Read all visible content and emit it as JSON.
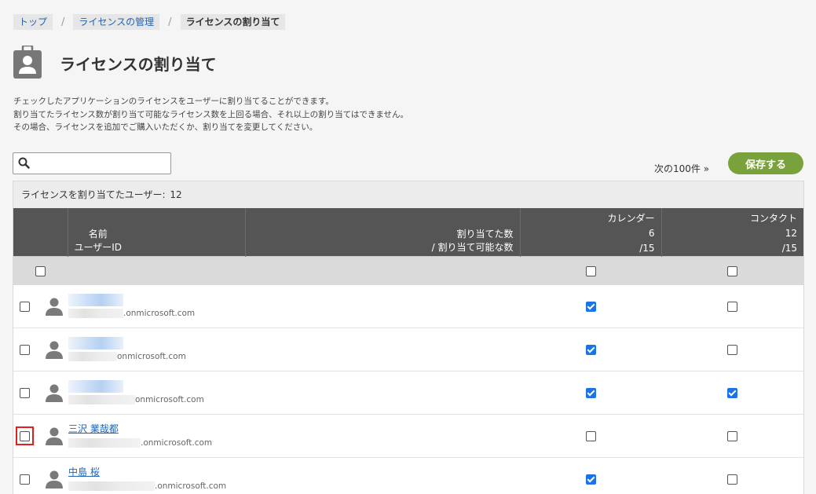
{
  "breadcrumb": {
    "top": "トップ",
    "license_mgmt": "ライセンスの管理",
    "current": "ライセンスの割り当て"
  },
  "page": {
    "title": "ライセンスの割り当て",
    "icon": "badge-user-icon"
  },
  "description": [
    "チェックしたアプリケーションのライセンスをユーザーに割り当てることができます。",
    "割り当てたライセンス数が割り当て可能なライセンス数を上回る場合、それ以上の割り当てはできません。",
    "その場合、ライセンスを追加でご購入いただくか、割り当てを変更してください。"
  ],
  "search": {
    "value": "",
    "placeholder": ""
  },
  "toolbar": {
    "next_label": "次の100件 »",
    "save_label": "保存する",
    "save_color": "#7aa23c"
  },
  "summary": {
    "label": "ライセンスを割り当てたユーザー:",
    "count": "12"
  },
  "table": {
    "col_name_1": "名前",
    "col_name_2": "ユーザーID",
    "col_count_1": "割り当てた数",
    "col_count_2": "/ 割り当て可能な数",
    "apps": [
      {
        "name": "カレンダー",
        "assigned": "6",
        "total": "/15"
      },
      {
        "name": "コンタクト",
        "assigned": "12",
        "total": "/15"
      }
    ],
    "rows": [
      {
        "name": "",
        "id": ".onmicrosoft.com",
        "selected": false,
        "calendar": true,
        "contact": false
      },
      {
        "name": "",
        "id": "onmicrosoft.com",
        "selected": false,
        "calendar": true,
        "contact": false
      },
      {
        "name": "",
        "id": "onmicrosoft.com",
        "selected": false,
        "calendar": true,
        "contact": true
      },
      {
        "name": "三沢 業哉都",
        "id": ".onmicrosoft.com",
        "selected": false,
        "calendar": false,
        "contact": false,
        "highlighted": true
      },
      {
        "name": "中島 桜",
        "id": ".onmicrosoft.com",
        "selected": false,
        "calendar": true,
        "contact": false
      }
    ]
  },
  "colors": {
    "link": "#1f63b6",
    "header_bg": "#555555",
    "checkbox_on": "#1a73e8",
    "highlight": "#e02020"
  }
}
